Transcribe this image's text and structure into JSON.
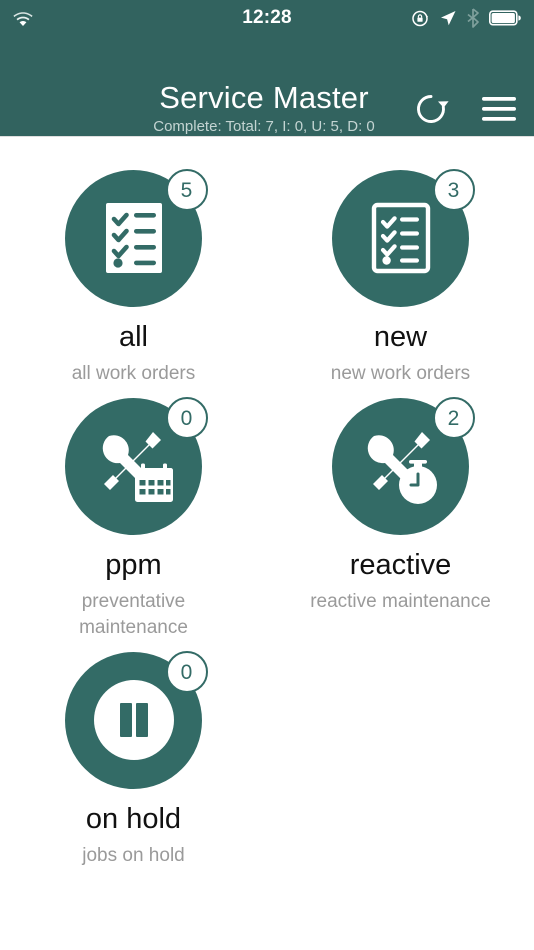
{
  "theme": {
    "header_bg": "#32635F",
    "accent": "#336B66",
    "page_bg": "#ffffff",
    "title_color": "#111111",
    "subtitle_color": "#9a9a9a",
    "badge_text_color": "#336B66"
  },
  "status_bar": {
    "time": "12:28",
    "icons_left": [
      "wifi-icon"
    ],
    "icons_right": [
      "rotation-lock-icon",
      "location-arrow-icon",
      "bluetooth-icon",
      "battery-icon"
    ]
  },
  "app_bar": {
    "title": "Service Master",
    "subtitle": "Complete: Total: 7, I: 0, U: 5, D: 0",
    "refresh_icon": "refresh-icon",
    "menu_icon": "hamburger-menu-icon"
  },
  "tiles": [
    {
      "key": "all",
      "title": "all",
      "subtitle": "all work orders",
      "badge": "5",
      "icon": "clipboard-checklist-filled-icon"
    },
    {
      "key": "new",
      "title": "new",
      "subtitle": "new work orders",
      "badge": "3",
      "icon": "clipboard-checklist-outline-icon"
    },
    {
      "key": "ppm",
      "title": "ppm",
      "subtitle": "preventative maintenance",
      "badge": "0",
      "icon": "tools-calendar-icon"
    },
    {
      "key": "reactive",
      "title": "reactive",
      "subtitle": "reactive maintenance",
      "badge": "2",
      "icon": "tools-stopwatch-icon"
    },
    {
      "key": "on-hold",
      "title": "on hold",
      "subtitle": "jobs on hold",
      "badge": "0",
      "icon": "pause-circle-icon"
    }
  ]
}
